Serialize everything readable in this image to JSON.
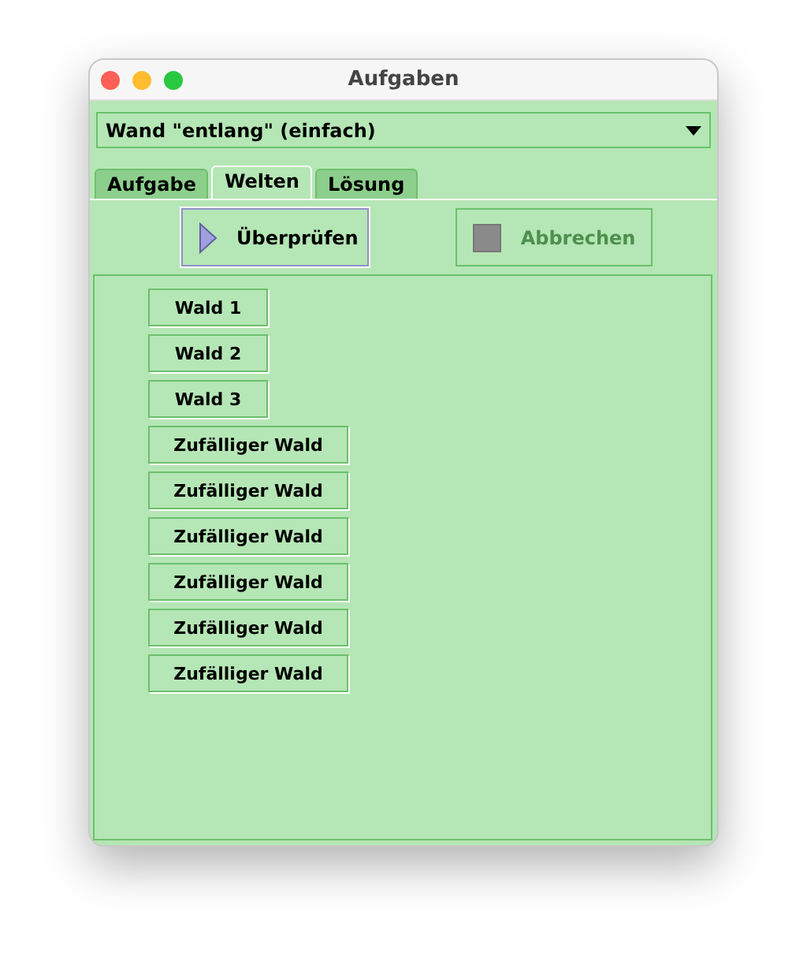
{
  "window": {
    "title": "Aufgaben"
  },
  "dropdown": {
    "value": "Wand \"entlang\" (einfach)"
  },
  "tabs": [
    {
      "label": "Aufgabe",
      "selected": false
    },
    {
      "label": "Welten",
      "selected": true
    },
    {
      "label": "Lösung",
      "selected": false
    }
  ],
  "toolbar": [
    {
      "label": "Überprüfen",
      "kind": "play",
      "disabled": false
    },
    {
      "label": "Abbrechen",
      "kind": "stop",
      "disabled": true
    }
  ],
  "worlds": [
    {
      "label": "Wald 1",
      "kind": "fixed"
    },
    {
      "label": "Wald 2",
      "kind": "fixed"
    },
    {
      "label": "Wald 3",
      "kind": "fixed"
    },
    {
      "label": "Zufälliger Wald",
      "kind": "random"
    },
    {
      "label": "Zufälliger Wald",
      "kind": "random"
    },
    {
      "label": "Zufälliger Wald",
      "kind": "random"
    },
    {
      "label": "Zufälliger Wald",
      "kind": "random"
    },
    {
      "label": "Zufälliger Wald",
      "kind": "random"
    },
    {
      "label": "Zufälliger Wald",
      "kind": "random"
    }
  ]
}
